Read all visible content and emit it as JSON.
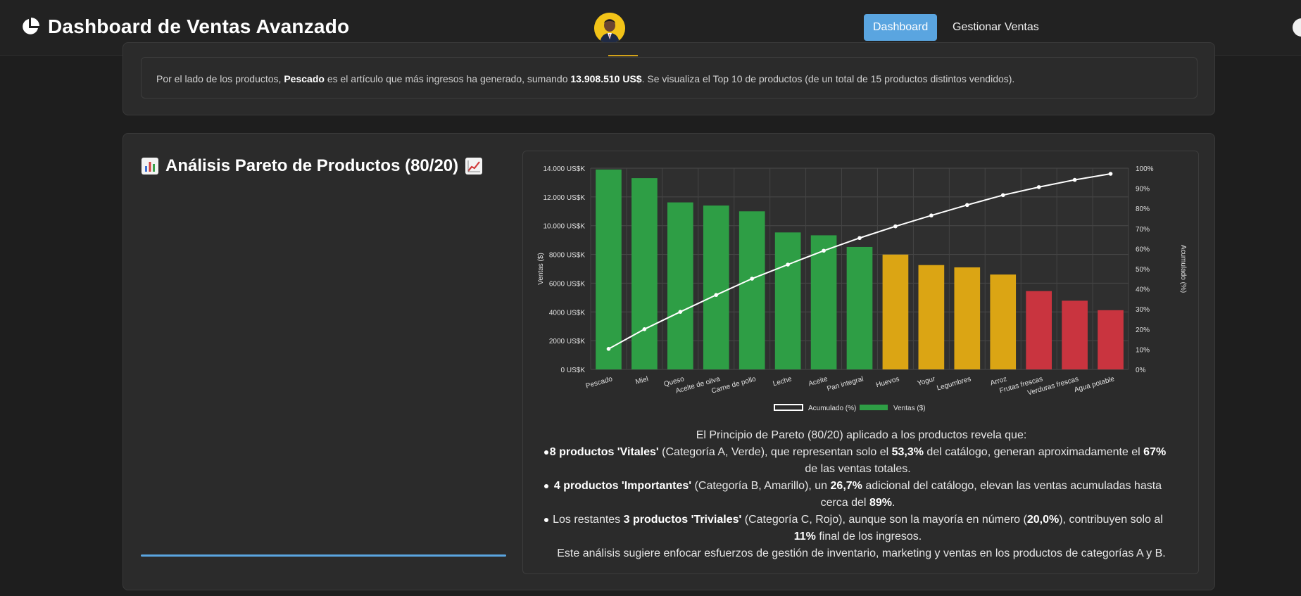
{
  "header": {
    "title": "Dashboard de Ventas Avanzado",
    "nav": [
      {
        "label": "Dashboard",
        "active": true
      },
      {
        "label": "Gestionar Ventas",
        "active": false
      }
    ]
  },
  "summary": {
    "text_1": "Por el lado de los productos, ",
    "product": "Pescado",
    "text_2": " es el artículo que más ingresos ha generado, sumando ",
    "amount": "13.908.510 US$",
    "text_3": ". Se visualiza el Top 10 de productos (de un total de 15 productos distintos vendidos)."
  },
  "pareto": {
    "title": "Análisis Pareto de Productos (80/20)",
    "title_icon_left": "bar-chart-emoji-icon",
    "title_icon_right": "chart-increasing-emoji-icon"
  },
  "analysis": {
    "intro": "El Principio de Pareto (80/20) aplicado a los productos revela que:",
    "item1_a": "8 productos 'Vitales'",
    "item1_b": " (Categoría A, Verde), que representan solo el ",
    "item1_c": "53,3%",
    "item1_d": " del catálogo, generan aproximadamente el ",
    "item1_e": "67%",
    "item1_f": " de las ventas totales.",
    "item2_a": "4 productos 'Importantes'",
    "item2_b": " (Categoría B, Amarillo), un ",
    "item2_c": "26,7%",
    "item2_d": " adicional del catálogo, elevan las ventas acumuladas hasta cerca del ",
    "item2_e": "89%",
    "item2_f": ".",
    "item3_a": "Los restantes ",
    "item3_b": "3 productos 'Triviales'",
    "item3_c": " (Categoría C, Rojo), aunque son la mayoría en número (",
    "item3_d": "20,0%",
    "item3_e": "), contribuyen solo al ",
    "item3_f": "11%",
    "item3_g": " final de los ingresos.",
    "conclusion": "Este análisis sugiere enfocar esfuerzos de gestión de inventario, marketing y ventas en los productos de categorías A y B."
  },
  "colors": {
    "accent_blue": "#5aa5e0",
    "cat_a": "#2e9e45",
    "cat_b": "#dba514",
    "cat_c": "#c9343f",
    "line": "#ffffff"
  },
  "chart_data": {
    "type": "bar",
    "categories": [
      "Pescado",
      "Miel",
      "Queso",
      "Aceite de oliva",
      "Carne de pollo",
      "Leche",
      "Aceite",
      "Pan integral",
      "Huevos",
      "Yogur",
      "Legumbres",
      "Arroz",
      "Frutas frescas",
      "Verduras frescas",
      "Agua potable"
    ],
    "series": [
      {
        "name": "Ventas ($)",
        "type": "bar",
        "axis": "left",
        "values": [
          13908,
          13310,
          11620,
          11400,
          11000,
          9530,
          9330,
          8520,
          7990,
          7260,
          7100,
          6600,
          5450,
          4780,
          4120
        ],
        "categories_class": [
          "A",
          "A",
          "A",
          "A",
          "A",
          "A",
          "A",
          "A",
          "B",
          "B",
          "B",
          "B",
          "C",
          "C",
          "C"
        ]
      },
      {
        "name": "Acumulado (%)",
        "type": "line",
        "axis": "right",
        "values": [
          10.2,
          20.0,
          28.6,
          37.0,
          45.1,
          52.1,
          59.0,
          65.3,
          71.1,
          76.5,
          81.7,
          86.6,
          90.6,
          94.2,
          97.2
        ]
      }
    ],
    "ylabel": "Ventas ($)",
    "y2label": "Acumulado (%)",
    "yticks": [
      "0 US$K",
      "2000 US$K",
      "4000 US$K",
      "6000 US$K",
      "8000 US$K",
      "10.000 US$K",
      "12.000 US$K",
      "14.000 US$K"
    ],
    "y2ticks": [
      "0%",
      "10%",
      "20%",
      "30%",
      "40%",
      "50%",
      "60%",
      "70%",
      "80%",
      "90%",
      "100%"
    ],
    "ylim": [
      0,
      14000
    ],
    "y2lim": [
      0,
      100
    ],
    "grid": true,
    "legend": [
      "Acumulado (%)",
      "Ventas ($)"
    ],
    "legend_position": "bottom"
  }
}
